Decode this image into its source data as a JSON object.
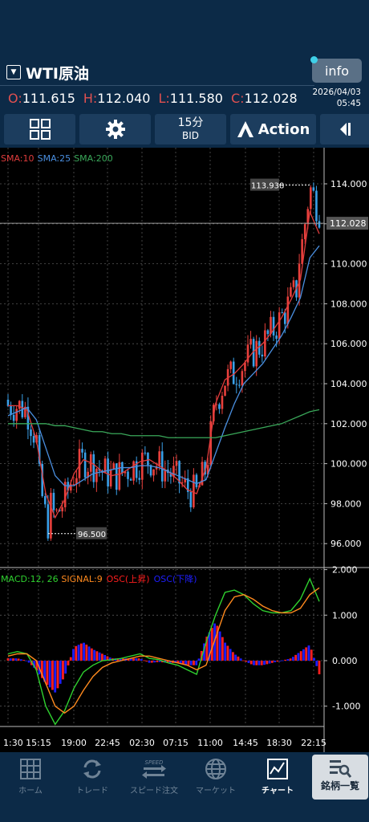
{
  "header": {
    "symbol": "WTI原油",
    "info_label": "info",
    "ohlc": {
      "o_label": "O:",
      "o": "111.615",
      "h_label": "H:",
      "h": "112.040",
      "l_label": "L:",
      "l": "111.580",
      "c_label": "C:",
      "c": "112.028"
    },
    "date": "2026/04/03",
    "time": "05:45"
  },
  "toolbar": {
    "timeframe": "15分",
    "price_side": "BID",
    "action_label": "Action"
  },
  "indicators": {
    "sma10": "SMA:10",
    "sma25": "SMA:25",
    "sma200": "SMA:200",
    "macd": "MACD:12, 26",
    "signal": "SIGNAL:9",
    "osc_up": "OSC(上昇)",
    "osc_down": "OSC(下降)"
  },
  "colors": {
    "sma10": "#e03c3c",
    "sma25": "#4a8fe0",
    "sma200": "#3aa85a",
    "macd": "#2fd12f",
    "signal": "#ff8a1e",
    "osc_up": "#ff1e1e",
    "osc_down": "#1e1eff"
  },
  "nav": [
    {
      "label": "ホーム",
      "icon": "home-grid-icon"
    },
    {
      "label": "トレード",
      "icon": "refresh-arrows-icon"
    },
    {
      "label": "スピード注文",
      "icon": "speed-arrows-icon"
    },
    {
      "label": "マーケット",
      "icon": "globe-icon"
    },
    {
      "label": "チャート",
      "icon": "chart-line-icon"
    },
    {
      "label": "銘柄一覧",
      "icon": "symbol-list-icon"
    }
  ],
  "chart_data": [
    {
      "type": "candlestick",
      "y_ticks": [
        "114.000",
        "112.000",
        "110.000",
        "108.000",
        "106.000",
        "104.000",
        "102.000",
        "100.000",
        "98.000",
        "96.000"
      ],
      "ylim": [
        95.0,
        114.5
      ],
      "x_ticks": [
        "1:30",
        "15:15",
        "19:00",
        "22:45",
        "02:30",
        "07:15",
        "11:00",
        "14:45",
        "18:30",
        "22:15"
      ],
      "current_price": "112.028",
      "high_label": "113.938",
      "low_label": "96.500",
      "series": [
        {
          "name": "SMA:10",
          "values": [
            102.9,
            102.9,
            102.7,
            101.2,
            98.5,
            97.3,
            98.2,
            99.5,
            100.2,
            100.0,
            99.6,
            99.4,
            99.5,
            99.8,
            100.1,
            100.2,
            99.9,
            99.6,
            99.2,
            98.7,
            98.5,
            99.8,
            103.0,
            104.2,
            104.5,
            105.0,
            105.6,
            106.0,
            106.6,
            107.3,
            108.2,
            109.2,
            112.6,
            111.5
          ]
        },
        {
          "name": "SMA:25",
          "values": [
            102.4,
            102.6,
            102.8,
            102.2,
            100.8,
            99.4,
            98.9,
            98.9,
            99.2,
            99.5,
            99.6,
            99.7,
            99.8,
            99.8,
            99.9,
            99.9,
            99.8,
            99.6,
            99.4,
            99.2,
            99.0,
            99.2,
            100.5,
            101.8,
            103.0,
            104.0,
            104.5,
            105.0,
            105.7,
            106.4,
            107.3,
            108.3,
            110.3,
            110.9
          ]
        },
        {
          "name": "SMA:200",
          "values": [
            102.0,
            102.0,
            102.0,
            102.0,
            102.0,
            101.9,
            101.9,
            101.8,
            101.7,
            101.6,
            101.6,
            101.5,
            101.5,
            101.4,
            101.4,
            101.4,
            101.4,
            101.3,
            101.3,
            101.3,
            101.3,
            101.3,
            101.3,
            101.4,
            101.5,
            101.6,
            101.7,
            101.8,
            101.9,
            102.0,
            102.2,
            102.4,
            102.6,
            102.7
          ]
        }
      ]
    },
    {
      "type": "line",
      "y_ticks": [
        "2.000",
        "1.000",
        "0.000",
        "-1.000"
      ],
      "ylim": [
        -1.6,
        2.1
      ],
      "series": [
        {
          "name": "MACD:12, 26",
          "values": [
            0.15,
            0.2,
            0.15,
            -0.2,
            -1.0,
            -1.4,
            -1.1,
            -0.6,
            -0.25,
            -0.1,
            0.0,
            0.02,
            0.05,
            0.1,
            0.15,
            0.05,
            0.02,
            -0.05,
            -0.1,
            -0.2,
            -0.3,
            0.4,
            1.0,
            1.5,
            1.55,
            1.45,
            1.25,
            1.1,
            1.05,
            1.05,
            1.1,
            1.35,
            1.8,
            1.3
          ]
        },
        {
          "name": "SIGNAL:9",
          "values": [
            0.1,
            0.15,
            0.15,
            0.0,
            -0.5,
            -1.0,
            -1.15,
            -1.0,
            -0.65,
            -0.35,
            -0.15,
            -0.05,
            0.0,
            0.05,
            0.1,
            0.1,
            0.05,
            0.0,
            -0.05,
            -0.1,
            -0.2,
            -0.1,
            0.5,
            1.1,
            1.4,
            1.45,
            1.35,
            1.2,
            1.1,
            1.05,
            1.05,
            1.15,
            1.45,
            1.6
          ]
        },
        {
          "name": "OSC",
          "values": [
            0.05,
            0.05,
            0.0,
            -0.2,
            -0.5,
            -0.7,
            -0.35,
            0.3,
            0.4,
            0.25,
            0.15,
            0.05,
            0.05,
            0.05,
            0.05,
            -0.05,
            -0.03,
            -0.05,
            -0.05,
            -0.1,
            -0.1,
            0.5,
            0.85,
            0.4,
            0.15,
            0.0,
            -0.1,
            -0.1,
            -0.05,
            0.0,
            0.05,
            0.2,
            0.35,
            -0.3
          ]
        }
      ]
    }
  ]
}
